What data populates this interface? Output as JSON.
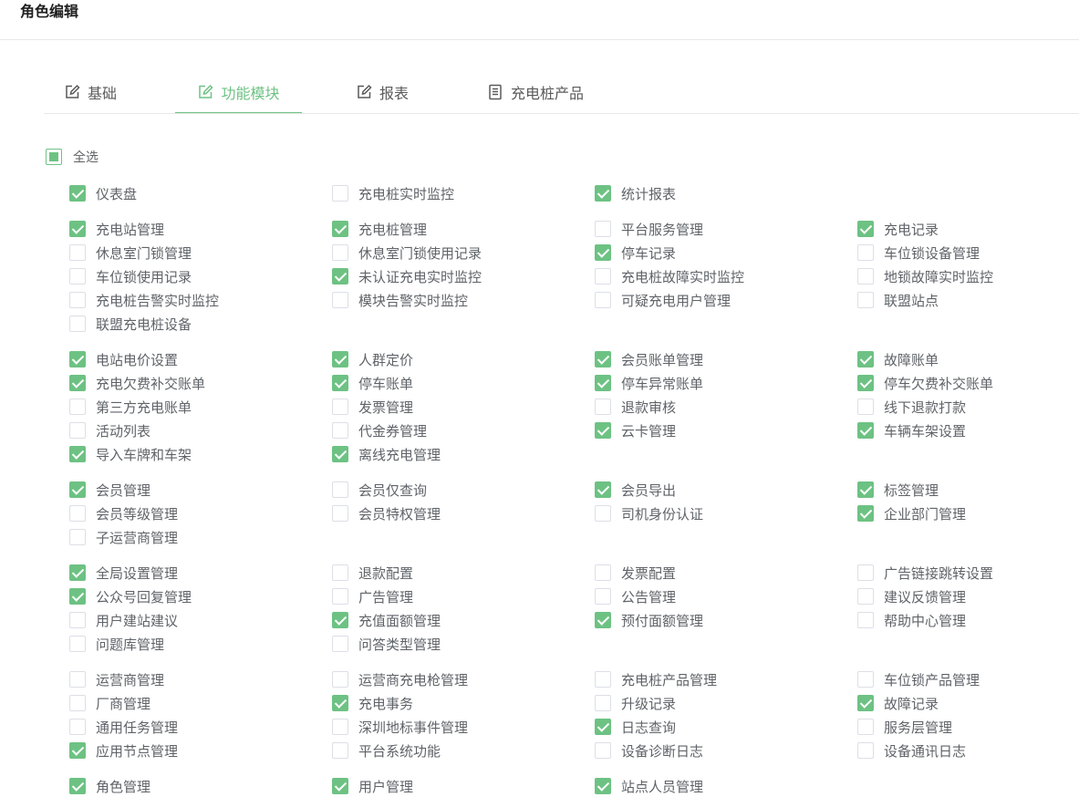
{
  "page": {
    "title": "角色编辑"
  },
  "tabs": [
    {
      "label": "基础",
      "icon": "edit-icon",
      "active": false
    },
    {
      "label": "功能模块",
      "icon": "edit-icon",
      "active": true
    },
    {
      "label": "报表",
      "icon": "edit-icon",
      "active": false
    },
    {
      "label": "充电桩产品",
      "icon": "document-icon",
      "active": false
    }
  ],
  "select_all": {
    "label": "全选",
    "state": "indeterminate"
  },
  "colors": {
    "accent": "#6dc283",
    "border": "#dcdfe6",
    "text": "#5f6368"
  },
  "groups": [
    {
      "rows": [
        [
          {
            "label": "仪表盘",
            "checked": true
          },
          {
            "label": "充电桩实时监控",
            "checked": false
          },
          {
            "label": "统计报表",
            "checked": true
          }
        ]
      ]
    },
    {
      "rows": [
        [
          {
            "label": "充电站管理",
            "checked": true
          },
          {
            "label": "充电桩管理",
            "checked": true
          },
          {
            "label": "平台服务管理",
            "checked": false
          },
          {
            "label": "充电记录",
            "checked": true
          }
        ],
        [
          {
            "label": "休息室门锁管理",
            "checked": false
          },
          {
            "label": "休息室门锁使用记录",
            "checked": false
          },
          {
            "label": "停车记录",
            "checked": true
          },
          {
            "label": "车位锁设备管理",
            "checked": false
          }
        ],
        [
          {
            "label": "车位锁使用记录",
            "checked": false
          },
          {
            "label": "未认证充电实时监控",
            "checked": true
          },
          {
            "label": "充电桩故障实时监控",
            "checked": false
          },
          {
            "label": "地锁故障实时监控",
            "checked": false
          }
        ],
        [
          {
            "label": "充电桩告警实时监控",
            "checked": false
          },
          {
            "label": "模块告警实时监控",
            "checked": false
          },
          {
            "label": "可疑充电用户管理",
            "checked": false
          },
          {
            "label": "联盟站点",
            "checked": false
          }
        ],
        [
          {
            "label": "联盟充电桩设备",
            "checked": false
          }
        ]
      ]
    },
    {
      "rows": [
        [
          {
            "label": "电站电价设置",
            "checked": true
          },
          {
            "label": "人群定价",
            "checked": true
          },
          {
            "label": "会员账单管理",
            "checked": true
          },
          {
            "label": "故障账单",
            "checked": true
          }
        ],
        [
          {
            "label": "充电欠费补交账单",
            "checked": true
          },
          {
            "label": "停车账单",
            "checked": true
          },
          {
            "label": "停车异常账单",
            "checked": true
          },
          {
            "label": "停车欠费补交账单",
            "checked": true
          }
        ],
        [
          {
            "label": "第三方充电账单",
            "checked": false
          },
          {
            "label": "发票管理",
            "checked": false
          },
          {
            "label": "退款审核",
            "checked": false
          },
          {
            "label": "线下退款打款",
            "checked": false
          }
        ],
        [
          {
            "label": "活动列表",
            "checked": false
          },
          {
            "label": "代金券管理",
            "checked": false
          },
          {
            "label": "云卡管理",
            "checked": true
          },
          {
            "label": "车辆车架设置",
            "checked": true
          }
        ],
        [
          {
            "label": "导入车牌和车架",
            "checked": true
          },
          {
            "label": "离线充电管理",
            "checked": true
          }
        ]
      ]
    },
    {
      "rows": [
        [
          {
            "label": "会员管理",
            "checked": true
          },
          {
            "label": "会员仅查询",
            "checked": false
          },
          {
            "label": "会员导出",
            "checked": true
          },
          {
            "label": "标签管理",
            "checked": true
          }
        ],
        [
          {
            "label": "会员等级管理",
            "checked": false
          },
          {
            "label": "会员特权管理",
            "checked": false
          },
          {
            "label": "司机身份认证",
            "checked": false
          },
          {
            "label": "企业部门管理",
            "checked": true
          }
        ],
        [
          {
            "label": "子运营商管理",
            "checked": false
          }
        ]
      ]
    },
    {
      "rows": [
        [
          {
            "label": "全局设置管理",
            "checked": true
          },
          {
            "label": "退款配置",
            "checked": false
          },
          {
            "label": "发票配置",
            "checked": false
          },
          {
            "label": "广告链接跳转设置",
            "checked": false
          }
        ],
        [
          {
            "label": "公众号回复管理",
            "checked": true
          },
          {
            "label": "广告管理",
            "checked": false
          },
          {
            "label": "公告管理",
            "checked": false
          },
          {
            "label": "建议反馈管理",
            "checked": false
          }
        ],
        [
          {
            "label": "用户建站建议",
            "checked": false
          },
          {
            "label": "充值面额管理",
            "checked": true
          },
          {
            "label": "预付面额管理",
            "checked": true
          },
          {
            "label": "帮助中心管理",
            "checked": false
          }
        ],
        [
          {
            "label": "问题库管理",
            "checked": false
          },
          {
            "label": "问答类型管理",
            "checked": false
          }
        ]
      ]
    },
    {
      "rows": [
        [
          {
            "label": "运营商管理",
            "checked": false
          },
          {
            "label": "运营商充电枪管理",
            "checked": false
          },
          {
            "label": "充电桩产品管理",
            "checked": false
          },
          {
            "label": "车位锁产品管理",
            "checked": false
          }
        ],
        [
          {
            "label": "厂商管理",
            "checked": false
          },
          {
            "label": "充电事务",
            "checked": true
          },
          {
            "label": "升级记录",
            "checked": false
          },
          {
            "label": "故障记录",
            "checked": true
          }
        ],
        [
          {
            "label": "通用任务管理",
            "checked": false
          },
          {
            "label": "深圳地标事件管理",
            "checked": false
          },
          {
            "label": "日志查询",
            "checked": true
          },
          {
            "label": "服务层管理",
            "checked": false
          }
        ],
        [
          {
            "label": "应用节点管理",
            "checked": true
          },
          {
            "label": "平台系统功能",
            "checked": false
          },
          {
            "label": "设备诊断日志",
            "checked": false
          },
          {
            "label": "设备通讯日志",
            "checked": false
          }
        ]
      ]
    },
    {
      "rows": [
        [
          {
            "label": "角色管理",
            "checked": true
          },
          {
            "label": "用户管理",
            "checked": true
          },
          {
            "label": "站点人员管理",
            "checked": true
          }
        ]
      ]
    }
  ]
}
